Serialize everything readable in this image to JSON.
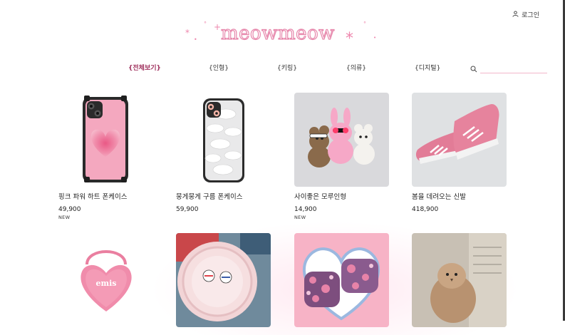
{
  "header": {
    "login_label": "로그인",
    "logo_text": "meowmeow"
  },
  "nav": {
    "items": [
      {
        "label": "{전체보기}",
        "active": true
      },
      {
        "label": "{인형}"
      },
      {
        "label": "{키링}"
      },
      {
        "label": "{의류}"
      },
      {
        "label": "{디지털}"
      }
    ]
  },
  "search": {
    "placeholder": "",
    "value": ""
  },
  "products": [
    {
      "name": "핑크 파워 하트 폰케이스",
      "price": "49,900",
      "badge": "NEW",
      "image": "pink-heart-phone-case"
    },
    {
      "name": "뭉게뭉게 구름 폰케이스",
      "price": "59,900",
      "badge": "",
      "image": "cloud-phone-case"
    },
    {
      "name": "사이좋은 모루인형",
      "price": "14,900",
      "badge": "NEW",
      "image": "plush-bears"
    },
    {
      "name": "봄을 데려오는 신발",
      "price": "418,900",
      "badge": "",
      "image": "pink-sneakers"
    },
    {
      "name": "",
      "price": "",
      "badge": "",
      "image": "pink-heart-bag",
      "bag_text": "emis"
    },
    {
      "name": "",
      "price": "",
      "badge": "",
      "image": "pink-plate-griptok"
    },
    {
      "name": "",
      "price": "",
      "badge": "",
      "image": "floral-airpods-case"
    },
    {
      "name": "",
      "price": "",
      "badge": "",
      "image": "fluffy-chick"
    }
  ],
  "colors": {
    "brand_pink": "#e789ad",
    "active_nav": "#a0325e",
    "search_underline": "#f2b6cb"
  }
}
